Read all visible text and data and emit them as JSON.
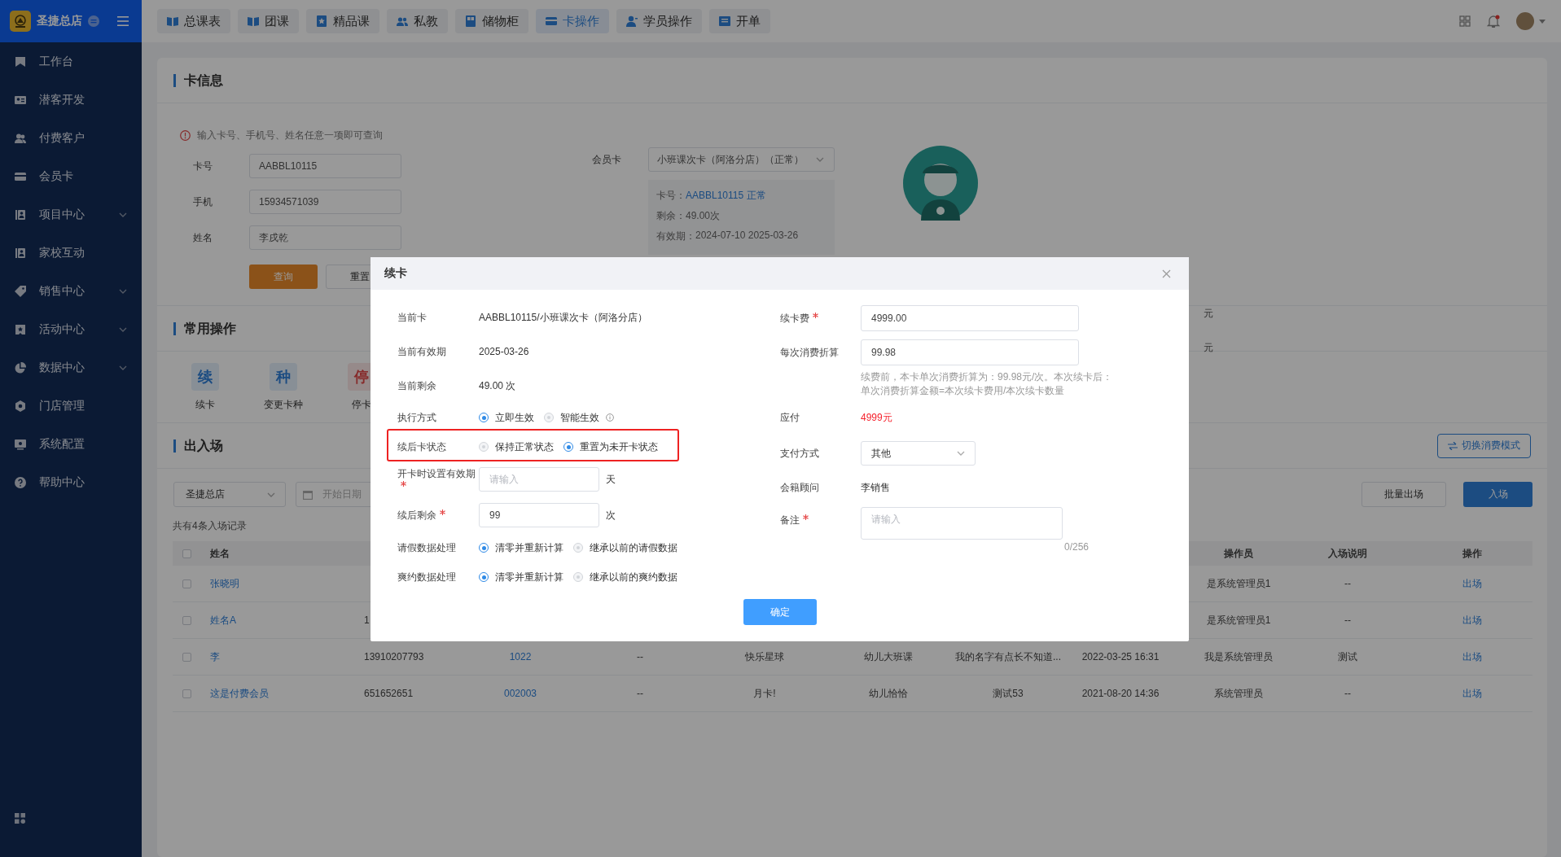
{
  "sidebar": {
    "store_name": "圣捷总店",
    "items": [
      {
        "label": "工作台",
        "has_children": false
      },
      {
        "label": "潜客开发",
        "has_children": false
      },
      {
        "label": "付费客户",
        "has_children": false
      },
      {
        "label": "会员卡",
        "has_children": false
      },
      {
        "label": "项目中心",
        "has_children": true
      },
      {
        "label": "家校互动",
        "has_children": false
      },
      {
        "label": "销售中心",
        "has_children": true
      },
      {
        "label": "活动中心",
        "has_children": true
      },
      {
        "label": "数据中心",
        "has_children": true
      },
      {
        "label": "门店管理",
        "has_children": false
      },
      {
        "label": "系统配置",
        "has_children": false
      },
      {
        "label": "帮助中心",
        "has_children": false
      }
    ]
  },
  "topnav": {
    "tabs": [
      {
        "label": "总课表",
        "selected": false
      },
      {
        "label": "团课",
        "selected": false
      },
      {
        "label": "精品课",
        "selected": false
      },
      {
        "label": "私教",
        "selected": false
      },
      {
        "label": "储物柜",
        "selected": false
      },
      {
        "label": "卡操作",
        "selected": true
      },
      {
        "label": "学员操作",
        "selected": false
      },
      {
        "label": "开单",
        "selected": false
      }
    ],
    "notification_dot": true
  },
  "card_info": {
    "title": "卡信息",
    "hint": "输入卡号、手机号、姓名任意一项即可查询",
    "fields": [
      {
        "label": "卡号",
        "value": "AABBL10115"
      },
      {
        "label": "手机",
        "value": "15934571039"
      },
      {
        "label": "姓名",
        "value": "李戌乾"
      }
    ],
    "query_button": "查询",
    "reset_button": "重置",
    "member_card": {
      "label": "会员卡",
      "value": "小班课次卡（阿洛分店）（正常）"
    },
    "details": [
      {
        "kind": "link",
        "label": "卡号：",
        "value": "AABBL10115 正常"
      },
      {
        "kind": "plain",
        "label": "剩余：",
        "value": "49.00次"
      },
      {
        "kind": "plain",
        "label": "有效期：",
        "value": "2024-07-10  2025-03-26"
      }
    ]
  },
  "operations": {
    "title": "常用操作",
    "items": [
      {
        "glyph": "续",
        "label": "续卡",
        "kind": "primary"
      },
      {
        "glyph": "种",
        "label": "变更卡种",
        "kind": "primary"
      },
      {
        "glyph": "停",
        "label": "停卡",
        "kind": "danger"
      }
    ],
    "units": [
      "元",
      "元"
    ]
  },
  "entries": {
    "title": "出入场",
    "mode_button": "切换消费模式",
    "store_select": "圣捷总店",
    "date_placeholder": "开始日期",
    "batch_exit_button": "批量出场",
    "enter_button": "入场",
    "record_count": "共有4条入场记录",
    "table": {
      "select_all_checked": false,
      "header": {
        "name": "姓名",
        "operator": "操作员",
        "entry_note": "入场说明",
        "action": "操作"
      },
      "rows": [
        {
          "checked": false,
          "name": "张晓明",
          "operator": "是系统管理员1",
          "entry_note": "--",
          "action": "出场"
        },
        {
          "checked": false,
          "name": "姓名A",
          "column_2": "1",
          "operator": "是系统管理员1",
          "entry_note": "--",
          "action": "出场"
        },
        {
          "checked": false,
          "name": "李",
          "column_2": "13910207793",
          "column_3": "1022",
          "column_4": "--",
          "column_5": "快乐星球",
          "column_6": "幼儿大班课",
          "column_7": "我的名字有点长不知道...",
          "column_8": "2022-03-25 16:31",
          "operator": "我是系统管理员",
          "entry_note": "测试",
          "action": "出场"
        },
        {
          "checked": false,
          "name": "这是付费会员",
          "column_2": "651652651",
          "column_3": "002003",
          "column_4": "--",
          "column_5": "月卡!",
          "column_6": "幼儿恰恰",
          "column_7": "测试53",
          "column_8": "2021-08-20 14:36",
          "operator": "系统管理员",
          "entry_note": "--",
          "action": "出场"
        }
      ]
    }
  },
  "dialog": {
    "title": "续卡",
    "confirm_button": "确定",
    "left_fields": [
      {
        "kind": "text",
        "label": "当前卡",
        "value": "AABBL10115/小班课次卡（阿洛分店）"
      },
      {
        "kind": "text",
        "label": "当前有效期",
        "value": "2025-03-26"
      },
      {
        "kind": "text",
        "label": "当前剩余",
        "value": "49.00 次"
      },
      {
        "kind": "radio",
        "label": "执行方式",
        "highlighted": false,
        "options": [
          {
            "label": "立即生效",
            "selected": true,
            "info": false
          },
          {
            "label": "智能生效",
            "selected": false,
            "info": true
          }
        ]
      },
      {
        "kind": "radio",
        "label": "续后卡状态",
        "highlighted": true,
        "options": [
          {
            "label": "保持正常状态",
            "selected": false,
            "info": false
          },
          {
            "label": "重置为未开卡状态",
            "selected": true,
            "info": false
          }
        ]
      },
      {
        "kind": "input",
        "label": "开卡时设置有效期",
        "required": true,
        "placeholder": "请输入",
        "unit": "天"
      },
      {
        "kind": "input",
        "label": "续后剩余",
        "required": true,
        "value": "99",
        "unit": "次"
      },
      {
        "kind": "radio",
        "label": "请假数据处理",
        "highlighted": false,
        "options": [
          {
            "label": "清零并重新计算",
            "selected": true,
            "info": false
          },
          {
            "label": "继承以前的请假数据",
            "selected": false,
            "info": false
          }
        ]
      },
      {
        "kind": "radio",
        "label": "爽约数据处理",
        "highlighted": false,
        "options": [
          {
            "label": "清零并重新计算",
            "selected": true,
            "info": false
          },
          {
            "label": "继承以前的爽约数据",
            "selected": false,
            "info": false
          }
        ]
      }
    ],
    "right_fields": [
      {
        "kind": "input",
        "label": "续卡费",
        "required": true,
        "value": "4999.00"
      },
      {
        "kind": "input",
        "label": "每次消费折算",
        "required": false,
        "value": "99.98"
      },
      {
        "kind": "hint",
        "lines": [
          "续费前，本卡单次消费折算为：99.98元/次。本次续卡后：",
          "单次消费折算金额=本次续卡费用/本次续卡数量"
        ]
      },
      {
        "kind": "amount",
        "label": "应付",
        "value": "4999元"
      },
      {
        "kind": "select",
        "label": "支付方式",
        "value": "其他"
      },
      {
        "kind": "text",
        "label": "会籍顾问",
        "value": "李销售"
      },
      {
        "kind": "textarea",
        "label": "备注",
        "required": true,
        "placeholder": "请输入",
        "counter": "0/256"
      }
    ]
  }
}
